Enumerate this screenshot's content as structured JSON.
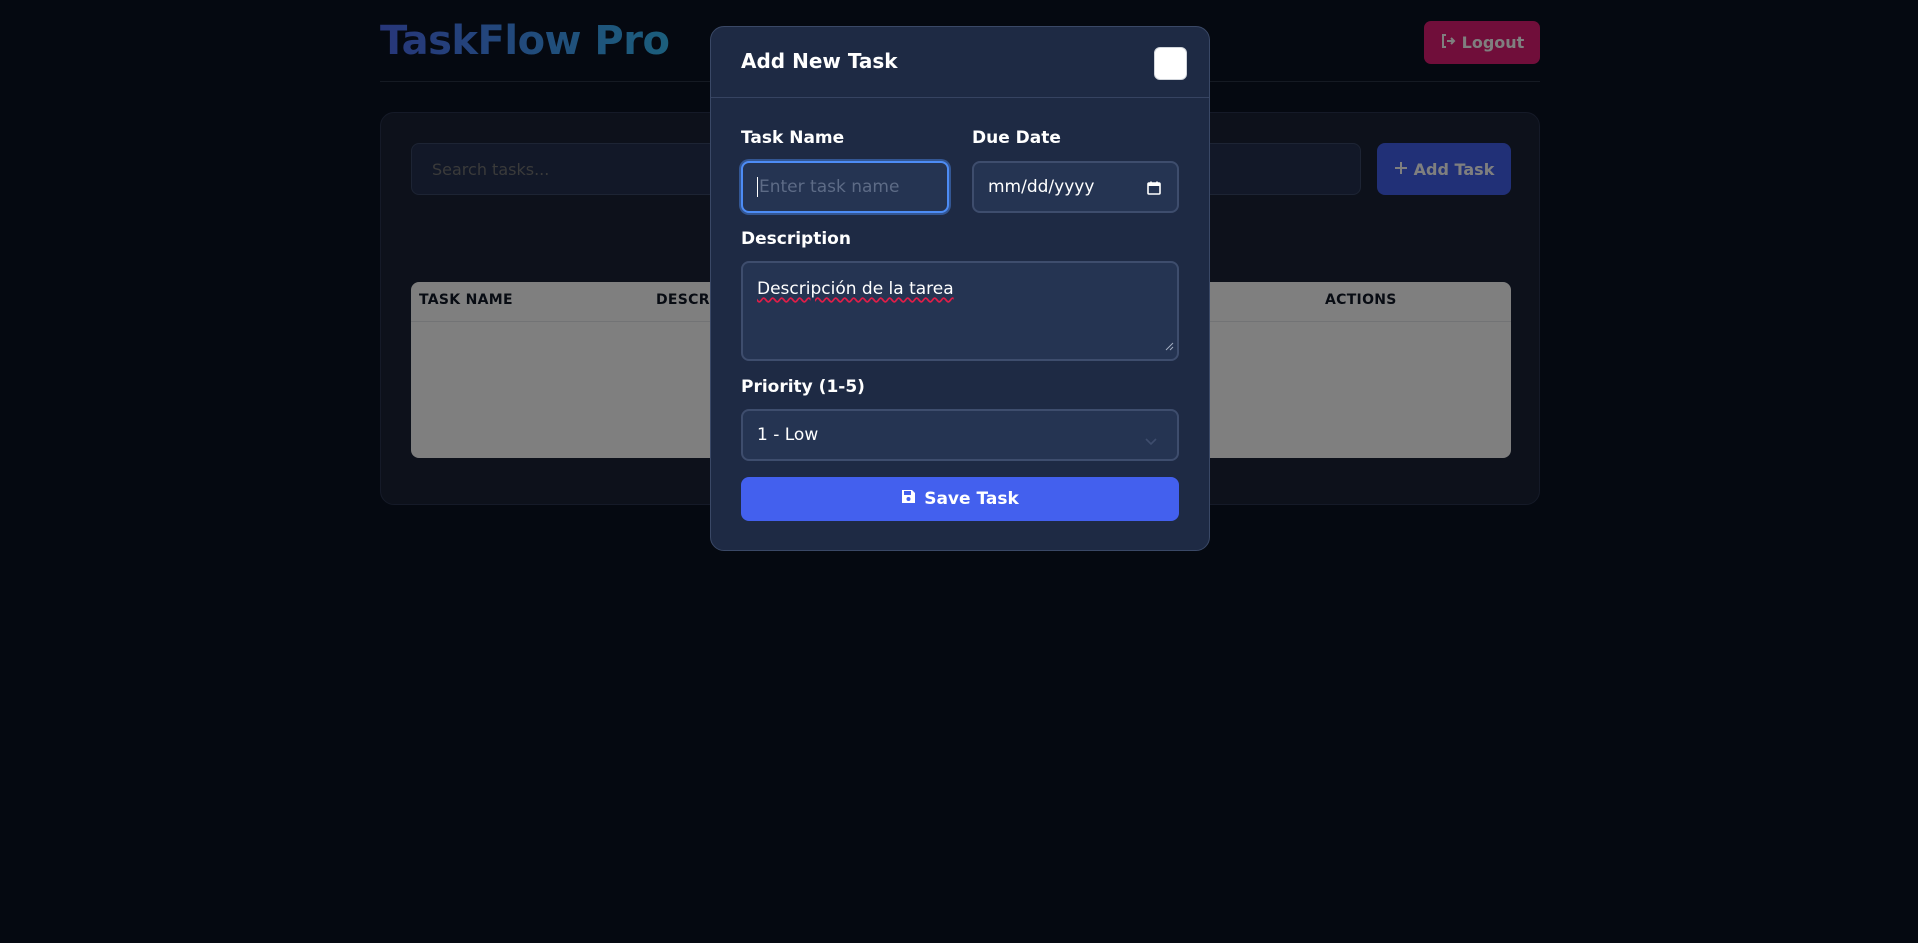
{
  "app": {
    "brand": "TaskFlow Pro",
    "logout_label": "Logout"
  },
  "toolbar": {
    "search_placeholder": "Search tasks...",
    "add_task_label": "Add Task"
  },
  "table": {
    "columns": [
      "TASK NAME",
      "DESCRI",
      "ACTIONS"
    ]
  },
  "modal": {
    "title": "Add New Task",
    "task_name_label": "Task Name",
    "task_name_placeholder": "Enter task name",
    "due_date_label": "Due Date",
    "due_date_value": "mm/dd/yyyy",
    "description_label": "Description",
    "description_value": "Descripción de la tarea",
    "priority_label": "Priority (1-5)",
    "priority_value": "1 - Low",
    "save_label": "Save Task"
  },
  "icons": {
    "logout": "logout-icon",
    "add": "plus-icon",
    "calendar": "calendar-icon",
    "save": "save-icon",
    "close": "close-icon",
    "chevron": "chevron-down-icon"
  },
  "colors": {
    "accent": "#4360ee",
    "danger": "#e11d74",
    "background": "#0b1222",
    "modal": "#1e2a44"
  }
}
